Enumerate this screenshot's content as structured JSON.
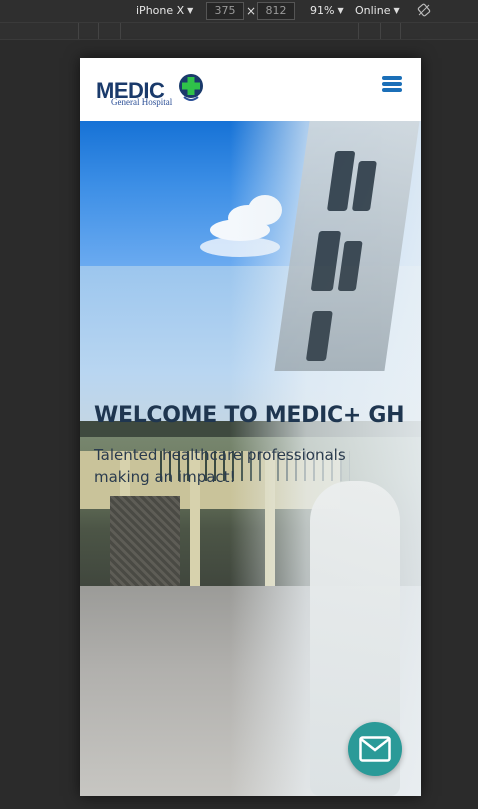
{
  "devtools": {
    "device": "iPhone X",
    "width_value": "375",
    "height_value": "812",
    "times": "×",
    "zoom": "91%",
    "network": "Online"
  },
  "site": {
    "logo_main": "MEDIC",
    "logo_sub": "General Hospital",
    "hero_title": "WELCOME TO MEDIC+ GH",
    "hero_subtitle": "Talented healthcare professionals making an impact!"
  },
  "colors": {
    "brand_blue": "#1a3a6b",
    "menu_blue": "#1b6fb8",
    "fab_teal": "#2a9a98",
    "cross_green": "#2fc24a"
  }
}
